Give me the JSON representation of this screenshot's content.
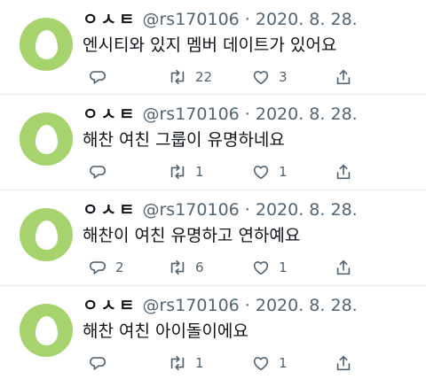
{
  "tweets": [
    {
      "name": "ㅇㅅㅌ",
      "handle": "@rs170106",
      "date": "· 2020. 8. 28.",
      "text": "엔시티와 있지 멤버 데이트가 있어요",
      "replies": "",
      "retweets": "22",
      "likes": "3"
    },
    {
      "name": "ㅇㅅㅌ",
      "handle": "@rs170106",
      "date": "· 2020. 8. 28.",
      "text": "해찬 여친 그룹이 유명하네요",
      "replies": "",
      "retweets": "1",
      "likes": "1"
    },
    {
      "name": "ㅇㅅㅌ",
      "handle": "@rs170106",
      "date": "· 2020. 8. 28.",
      "text": "해찬이 여친 유명하고 연하예요",
      "replies": "2",
      "retweets": "6",
      "likes": "1"
    },
    {
      "name": "ㅇㅅㅌ",
      "handle": "@rs170106",
      "date": "· 2020. 8. 28.",
      "text": "해찬 여친 아이돌이에요",
      "replies": "",
      "retweets": "1",
      "likes": "1"
    }
  ],
  "colors": {
    "avatar": "#a7d36f",
    "muted": "#536471",
    "text": "#0f1419",
    "separator": "#e6ecf0"
  }
}
